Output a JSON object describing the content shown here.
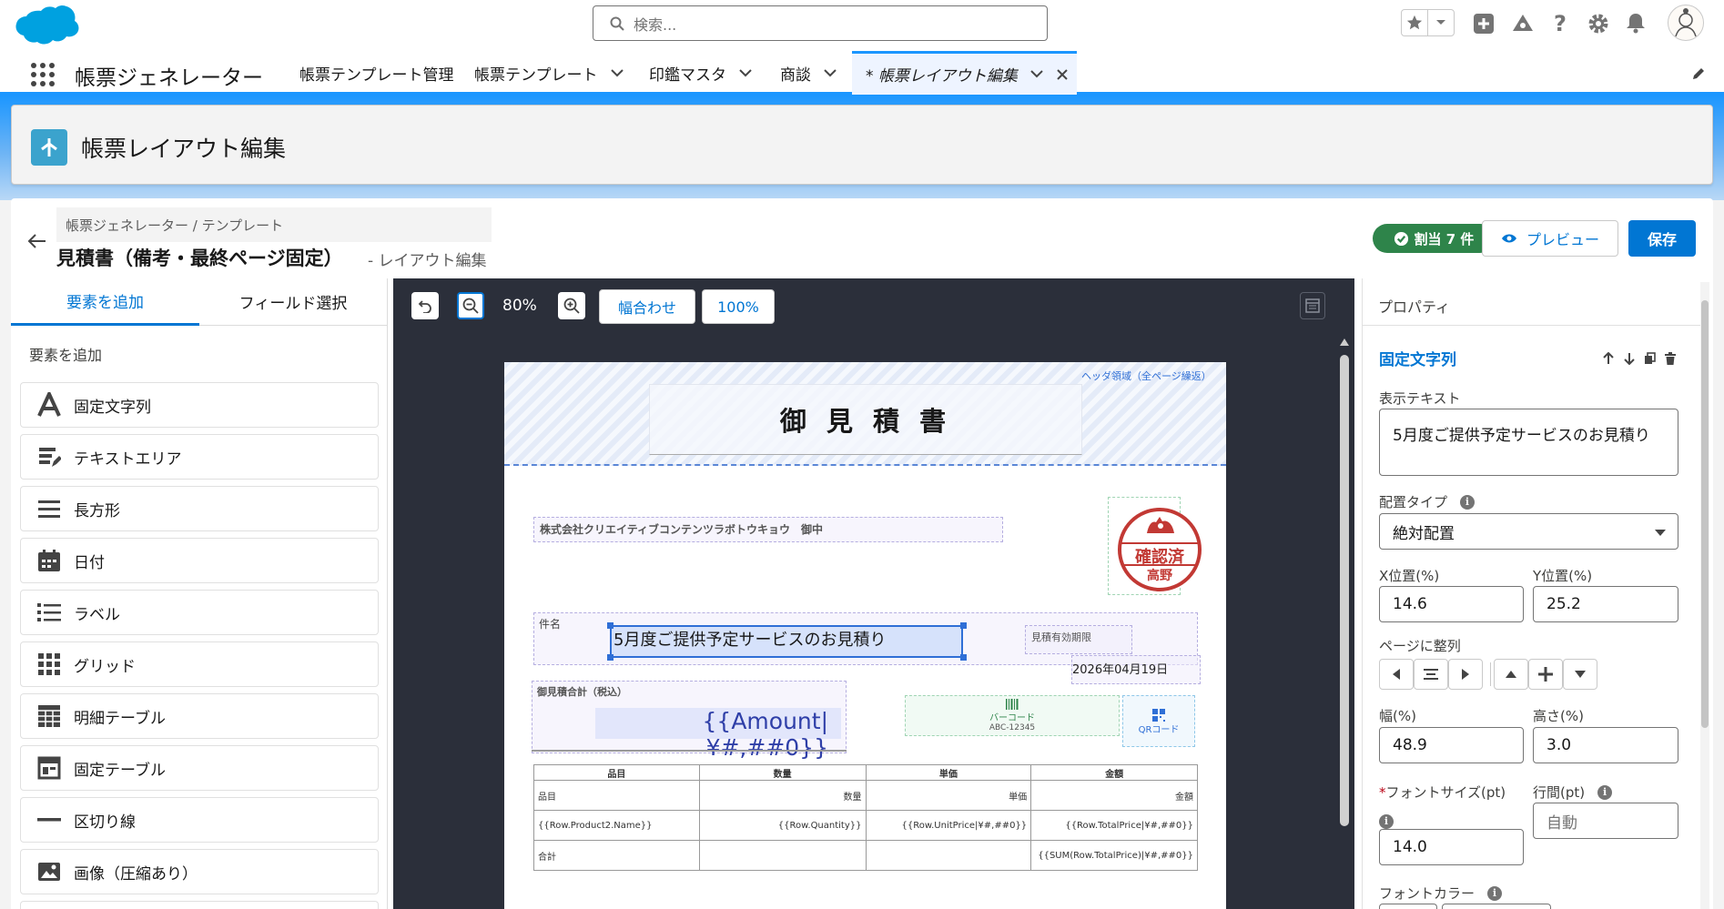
{
  "global": {
    "search_placeholder": "検索...",
    "app_name": "帳票ジェネレーター"
  },
  "nav_tabs": [
    {
      "label": "帳票テンプレート管理"
    },
    {
      "label": "帳票テンプレート"
    },
    {
      "label": "印鑑マスタ"
    },
    {
      "label": "商談"
    },
    {
      "label": "* 帳票レイアウト編集"
    }
  ],
  "page_header": {
    "title": "帳票レイアウト編集"
  },
  "editor": {
    "breadcrumb": "帳票ジェネレーター / テンプレート",
    "title": "見積書（備考・最終ページ固定）",
    "subtitle": "- レイアウト編集",
    "assigned_badge": "割当 7 件",
    "preview_label": "プレビュー",
    "save_label": "保存"
  },
  "left_panel": {
    "tabs": [
      "要素を追加",
      "フィールド選択"
    ],
    "section_label": "要素を追加",
    "items": [
      {
        "label": "固定文字列",
        "icon": "text-icon"
      },
      {
        "label": "テキストエリア",
        "icon": "textarea-icon"
      },
      {
        "label": "長方形",
        "icon": "rectangle-icon"
      },
      {
        "label": "日付",
        "icon": "calendar-icon"
      },
      {
        "label": "ラベル",
        "icon": "list-icon"
      },
      {
        "label": "グリッド",
        "icon": "grid-icon"
      },
      {
        "label": "明細テーブル",
        "icon": "table-icon"
      },
      {
        "label": "固定テーブル",
        "icon": "fixed-table-icon"
      },
      {
        "label": "区切り線",
        "icon": "divider-icon"
      },
      {
        "label": "画像（圧縮あり）",
        "icon": "image-icon"
      }
    ]
  },
  "canvas": {
    "zoom": "80%",
    "fit_width_label": "幅合わせ",
    "zoom_100_label": "100%",
    "header_area_label": "ヘッダ領域（全ページ繰返）",
    "doc_title": "御 見 積 書",
    "recipient": "株式会社クリエイティブコンテンツラボトウキョウ　御中",
    "subject_label": "件名",
    "subject_value": "5月度ご提供予定サービスのお見積り",
    "expiry_label": "見積有効期限",
    "expiry_date": "2026年04月19日",
    "total_label": "御見積合計（税込）",
    "total_value": "{{Amount|¥#,##0}}",
    "barcode_label": "バーコード",
    "barcode_value": "ABC-12345",
    "qr_label": "QRコード",
    "stamp_top": "確認済",
    "stamp_name": "高野",
    "table": {
      "headers": [
        "品目",
        "数量",
        "単価",
        "金額"
      ],
      "rows": [
        [
          "品目",
          "数量",
          "単価",
          "金額"
        ],
        [
          "{{Row.Product2.Name}}",
          "{{Row.Quantity}}",
          "{{Row.UnitPrice|¥#,##0}}",
          "{{Row.TotalPrice|¥#,##0}}"
        ],
        [
          "合計",
          "",
          "",
          "{{SUM(Row.TotalPrice)|¥#,##0}}"
        ]
      ]
    }
  },
  "properties": {
    "panel_title": "プロパティ",
    "element_type": "固定文字列",
    "display_text_label": "表示テキスト",
    "display_text_value": "5月度ご提供予定サービスのお見積り",
    "placement_label": "配置タイプ",
    "placement_value": "絶対配置",
    "x_label": "X位置(%)",
    "x_value": "14.6",
    "y_label": "Y位置(%)",
    "y_value": "25.2",
    "align_label": "ページに整列",
    "width_label": "幅(%)",
    "width_value": "48.9",
    "height_label": "高さ(%)",
    "height_value": "3.0",
    "font_size_label": "フォントサイズ(pt)",
    "font_size_value": "14.0",
    "line_height_label": "行間(pt)",
    "line_height_placeholder": "自動",
    "font_color_label": "フォントカラー"
  },
  "colors": {
    "brand": "#0176d3",
    "success": "#2e844a",
    "stamp": "#c23934",
    "canvas_bg": "#2b2f3a"
  }
}
